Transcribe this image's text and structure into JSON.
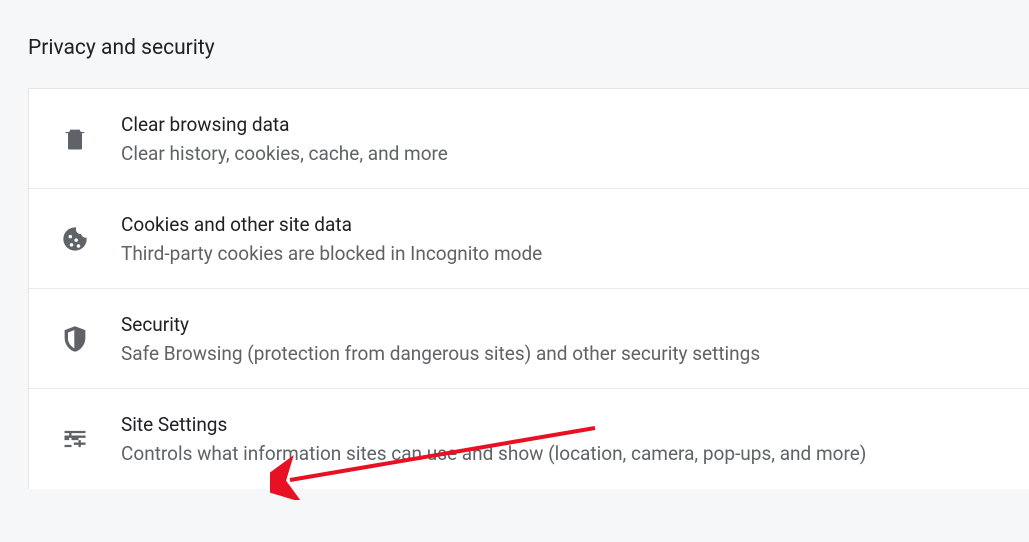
{
  "section": {
    "title": "Privacy and security"
  },
  "rows": [
    {
      "icon": "trash",
      "title": "Clear browsing data",
      "desc": "Clear history, cookies, cache, and more"
    },
    {
      "icon": "cookie",
      "title": "Cookies and other site data",
      "desc": "Third-party cookies are blocked in Incognito mode"
    },
    {
      "icon": "shield",
      "title": "Security",
      "desc": "Safe Browsing (protection from dangerous sites) and other security settings"
    },
    {
      "icon": "sliders",
      "title": "Site Settings",
      "desc": "Controls what information sites can use and show (location, camera, pop-ups, and more)"
    }
  ]
}
